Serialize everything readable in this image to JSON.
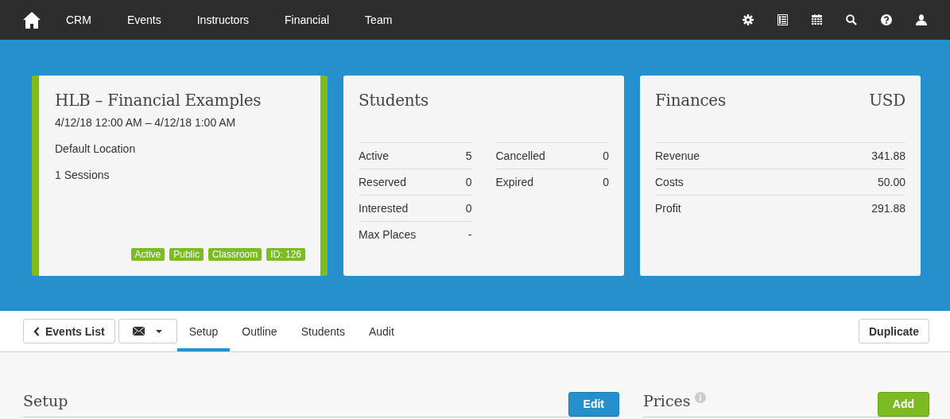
{
  "nav": {
    "items": [
      "CRM",
      "Events",
      "Instructors",
      "Financial",
      "Team"
    ]
  },
  "event": {
    "title": "HLB – Financial Examples",
    "dates": "4/12/18 12:00 AM – 4/12/18 1:00 AM",
    "location": "Default Location",
    "sessions": "1 Sessions",
    "tags": [
      "Active",
      "Public",
      "Classroom",
      "ID: 126"
    ]
  },
  "students": {
    "title": "Students",
    "columns": [
      [
        {
          "label": "Active",
          "value": "5"
        },
        {
          "label": "Reserved",
          "value": "0"
        },
        {
          "label": "Interested",
          "value": "0"
        },
        {
          "label": "Max Places",
          "value": "-"
        }
      ],
      [
        {
          "label": "Cancelled",
          "value": "0"
        },
        {
          "label": "Expired",
          "value": "0"
        }
      ]
    ]
  },
  "finances": {
    "title": "Finances",
    "currency": "USD",
    "rows": [
      {
        "label": "Revenue",
        "value": "341.88"
      },
      {
        "label": "Costs",
        "value": "50.00"
      },
      {
        "label": "Profit",
        "value": "291.88"
      }
    ]
  },
  "toolbar": {
    "back_button": "Events List",
    "tabs": [
      {
        "label": "Setup",
        "selected": true
      },
      {
        "label": "Outline",
        "selected": false
      },
      {
        "label": "Students",
        "selected": false
      },
      {
        "label": "Audit",
        "selected": false
      }
    ],
    "duplicate_button": "Duplicate"
  },
  "sections": [
    {
      "title": "Setup",
      "info": false,
      "button": {
        "label": "Edit",
        "kind": "primary"
      }
    },
    {
      "title": "Prices",
      "info": true,
      "button": {
        "label": "Add",
        "kind": "success"
      }
    }
  ]
}
